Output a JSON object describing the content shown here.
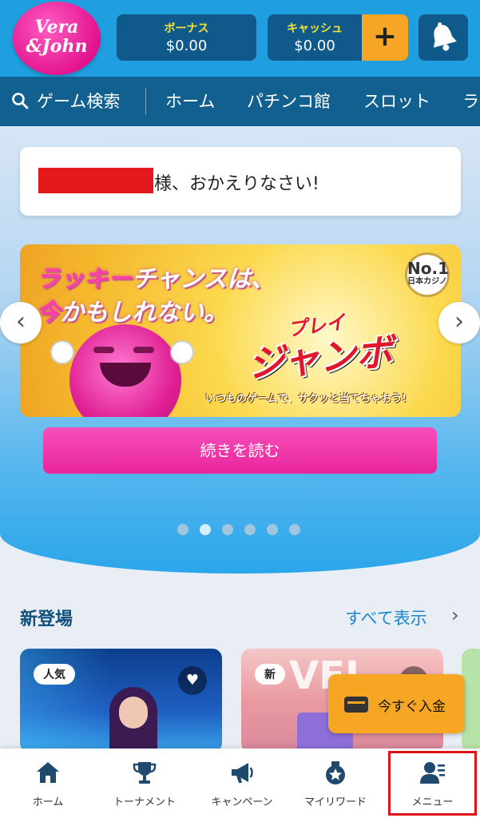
{
  "header": {
    "logo_text": "Vera&John",
    "bonus": {
      "label": "ボーナス",
      "value": "$0.00"
    },
    "cash": {
      "label": "キャッシュ",
      "value": "$0.00"
    },
    "add_funds_icon": "plus-icon",
    "notifications_icon": "bell-icon"
  },
  "nav": {
    "search_label": "ゲーム検索",
    "items": [
      "ホーム",
      "パチンコ館",
      "スロット",
      "ラ"
    ]
  },
  "welcome": {
    "text": "様、おかえりなさい!"
  },
  "banner": {
    "line1_highlight": "ラッキー",
    "line1_rest": "チャンスは、",
    "line2_highlight": "今",
    "line2_rest": "かもしれない。",
    "jumbo_small": "プレイ",
    "jumbo": "ジャンボ",
    "subtitle": "いつものゲームで、サクッと当てちゃおう!",
    "badge_no": "No.1",
    "badge_text": "日本カジノ"
  },
  "carousel": {
    "prev": "‹",
    "next": "›",
    "dots": 6,
    "active_dot": 1
  },
  "read_more_label": "続きを読む",
  "section": {
    "title": "新登場",
    "see_all": "すべて表示",
    "chevron": "›"
  },
  "games": [
    {
      "tag": "人気",
      "favorite_icon": "heart-icon"
    },
    {
      "tag": "新",
      "favorite_icon": "heart-icon"
    }
  ],
  "deposit": {
    "label": "今すぐ入金",
    "icon": "wallet-icon"
  },
  "bottom_nav": [
    {
      "label": "ホーム",
      "icon": "home-icon"
    },
    {
      "label": "トーナメント",
      "icon": "trophy-icon"
    },
    {
      "label": "キャンペーン",
      "icon": "megaphone-icon"
    },
    {
      "label": "マイリワード",
      "icon": "reward-medal-icon"
    },
    {
      "label": "メニュー",
      "icon": "user-menu-icon"
    }
  ],
  "colors": {
    "header_bg": "#1f9fe0",
    "nav_bg": "#12608f",
    "brand_pink": "#e3148f",
    "accent_orange": "#f6a525",
    "highlight_box": "#e0131a"
  }
}
